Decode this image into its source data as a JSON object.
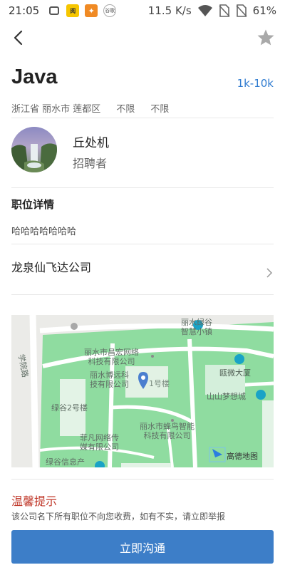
{
  "status_bar": {
    "time": "21:05",
    "net_speed": "11.5 K/s",
    "battery": "61%",
    "app_icon_label": "谷歌"
  },
  "job": {
    "title": "Java",
    "salary": "1k-10k",
    "location": "浙江省 丽水市 莲都区",
    "experience": "不限",
    "education": "不限"
  },
  "recruiter": {
    "name": "丘处机",
    "role": "招聘者"
  },
  "details": {
    "section_title": "职位详情",
    "description": "哈哈哈哈哈哈哈"
  },
  "company": {
    "name": "龙泉仙飞达公司"
  },
  "map": {
    "labels": {
      "changhong": "丽水市昌宏网络\n科技有限公司",
      "lvgu_town": "丽水绿谷\n智慧小镇",
      "bosheng": "丽水博远科\n技有限公司",
      "building1": "1号楼",
      "ouwei": "瓯微大厦",
      "shanshan": "山山梦想城",
      "road": "学院路",
      "lvgu2": "绿谷2号楼",
      "fengniao": "丽水市蜂鸟智能\n科技有限公司",
      "feifan": "菲凡网络传\n媒有限公司",
      "lvgu_info": "绿谷信息产",
      "watermark": "高德地图"
    }
  },
  "tip": {
    "title": "温馨提示",
    "text": "该公司名下所有职位不向您收费，如有不实，请立即举报"
  },
  "action": {
    "contact_label": "立即沟通"
  },
  "colors": {
    "accent": "#3d7ec8",
    "salary": "#2f7bd0",
    "tip_title": "#c0392b",
    "map_green": "#8fdca0"
  }
}
